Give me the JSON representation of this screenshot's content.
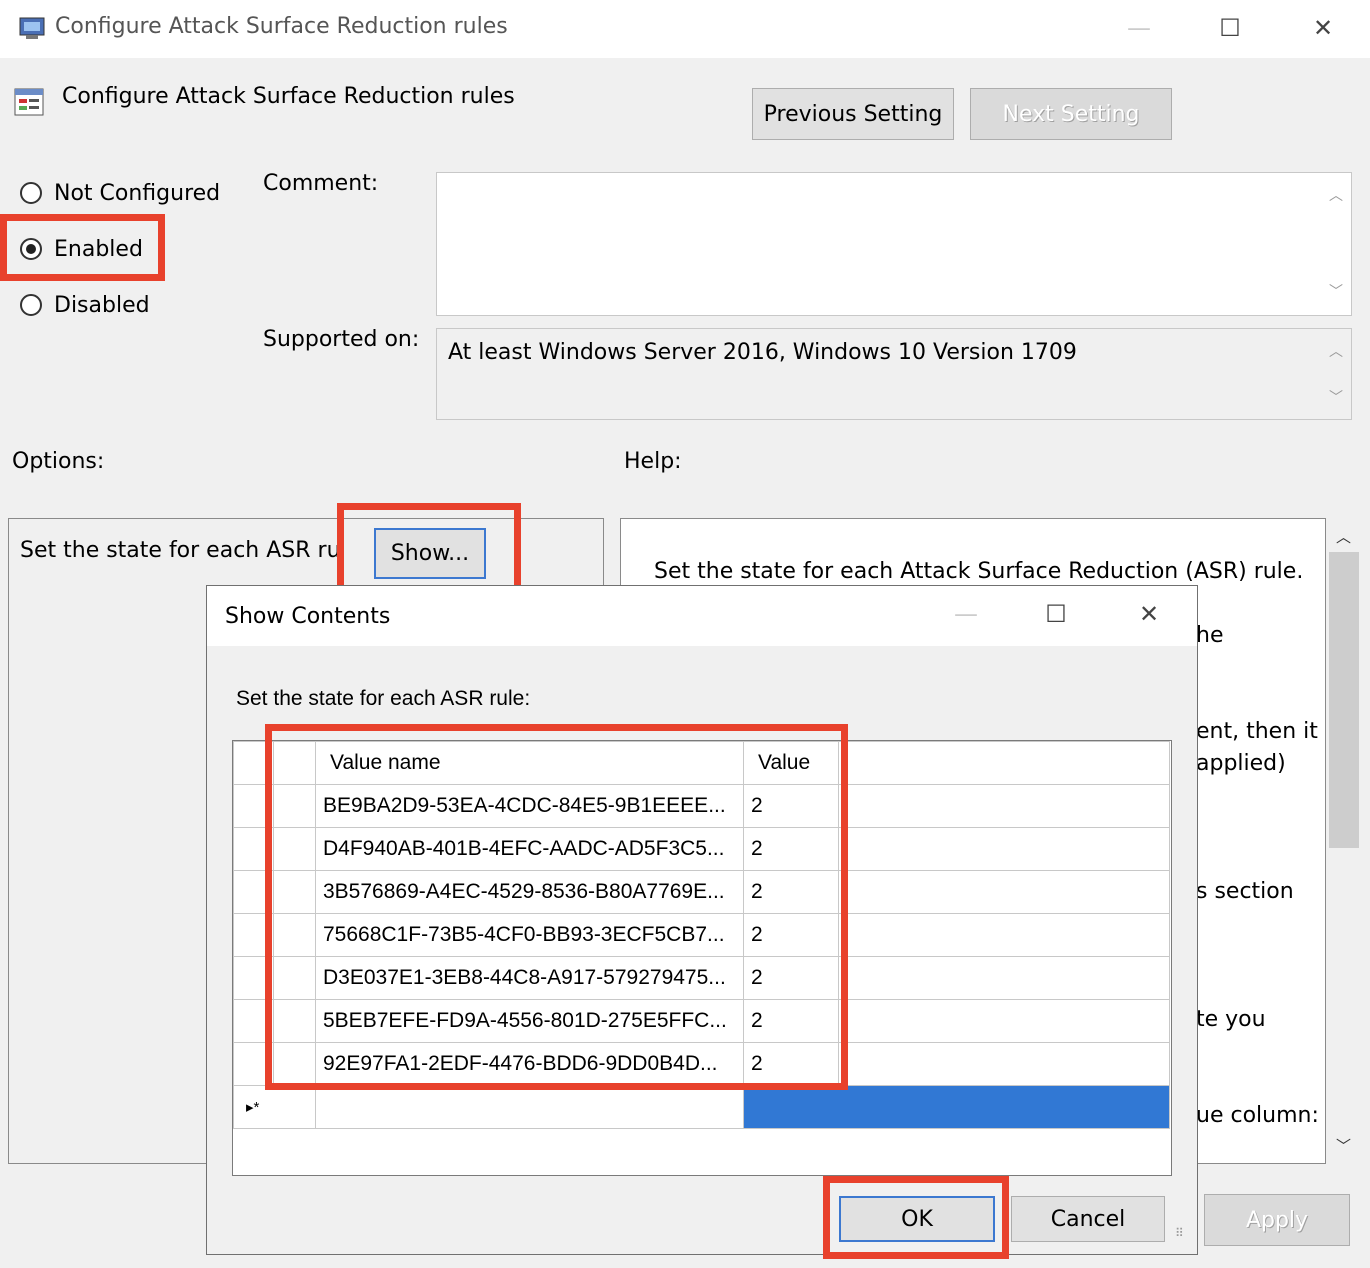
{
  "window": {
    "title": "Configure Attack Surface Reduction rules",
    "minimize_glyph": "—",
    "maximize_glyph": "☐",
    "close_glyph": "✕"
  },
  "setting": {
    "title": "Configure Attack Surface Reduction rules",
    "previous_label": "Previous Setting",
    "next_label": "Next Setting"
  },
  "state": {
    "options": [
      {
        "label": "Not Configured",
        "checked": false
      },
      {
        "label": "Enabled",
        "checked": true
      },
      {
        "label": "Disabled",
        "checked": false
      }
    ]
  },
  "comment": {
    "label": "Comment:",
    "value": ""
  },
  "supported_on": {
    "label": "Supported on:",
    "value": "At least Windows Server 2016, Windows 10 Version 1709"
  },
  "options_panel": {
    "label": "Options:",
    "row_text": "Set the state for each ASR rule",
    "show_button": "Show..."
  },
  "help_panel": {
    "label": "Help:",
    "lines": [
      "Set the state for each Attack Surface Reduction (ASR) rule.",
      "he",
      "ent, then it",
      "applied)",
      "s section",
      "te you",
      "ue column:"
    ]
  },
  "footer": {
    "apply_label": "Apply"
  },
  "dialog": {
    "title": "Show Contents",
    "minimize_glyph": "—",
    "maximize_glyph": "☐",
    "close_glyph": "✕",
    "instruction": "Set the state for each ASR rule:",
    "columns": [
      "Value name",
      "Value"
    ],
    "rows": [
      {
        "name": "BE9BA2D9-53EA-4CDC-84E5-9B1EEEE...",
        "value": "2"
      },
      {
        "name": "D4F940AB-401B-4EFC-AADC-AD5F3C5...",
        "value": "2"
      },
      {
        "name": "3B576869-A4EC-4529-8536-B80A7769E...",
        "value": "2"
      },
      {
        "name": "75668C1F-73B5-4CF0-BB93-3ECF5CB7...",
        "value": "2"
      },
      {
        "name": "D3E037E1-3EB8-44C8-A917-579279475...",
        "value": "2"
      },
      {
        "name": "5BEB7EFE-FD9A-4556-801D-275E5FFC...",
        "value": "2"
      },
      {
        "name": "92E97FA1-2EDF-4476-BDD6-9DD0B4D...",
        "value": "2"
      }
    ],
    "new_row_marker": "▸*",
    "ok_label": "OK",
    "cancel_label": "Cancel"
  },
  "colors": {
    "highlight_red": "#e8412c",
    "selection_blue": "#3178d4"
  }
}
